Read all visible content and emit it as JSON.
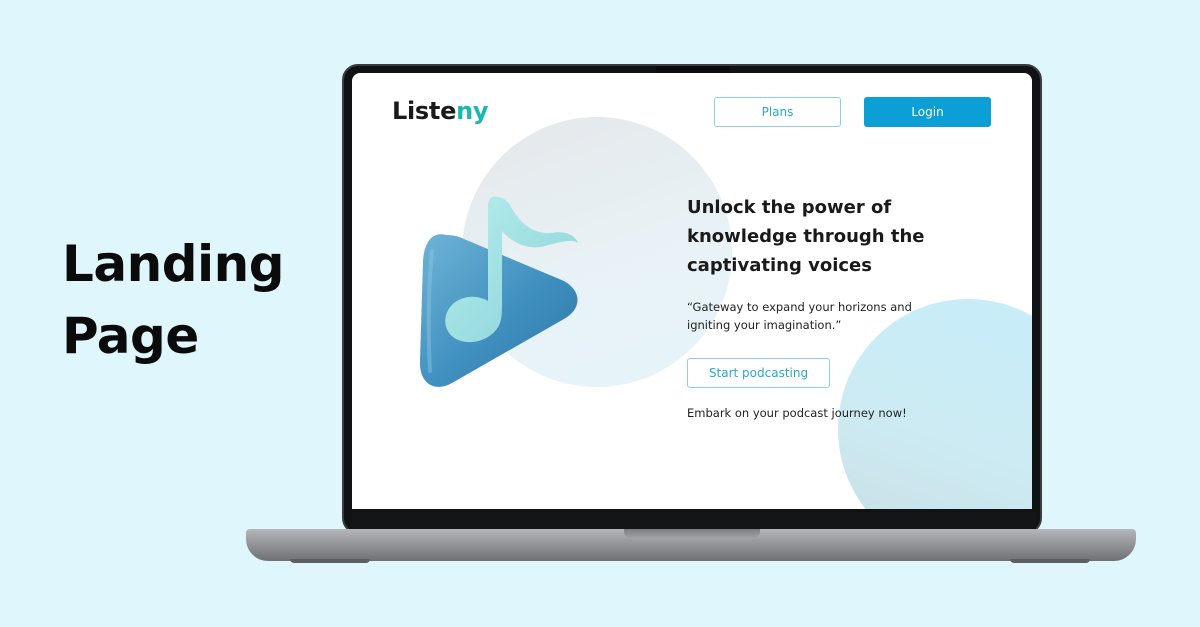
{
  "side": {
    "title_line1": "Landing",
    "title_line2": "Page"
  },
  "site": {
    "logo_main": "Liste",
    "logo_accent": "ny",
    "nav": {
      "plans_label": "Plans",
      "login_label": "Login"
    },
    "hero": {
      "heading": "Unlock the power of knowledge through the captivating voices",
      "quote": "“Gateway to expand your horizons and igniting your imagination.”",
      "cta_label": "Start podcasting",
      "cta_note": "Embark on your podcast journey now!",
      "illustration_icon": "play-music-note-icon"
    }
  },
  "colors": {
    "page_background": "#dff6fd",
    "brand_accent": "#19b8b0",
    "primary_button": "#0c9fd6",
    "outline_button_border": "#8fd0e2"
  }
}
